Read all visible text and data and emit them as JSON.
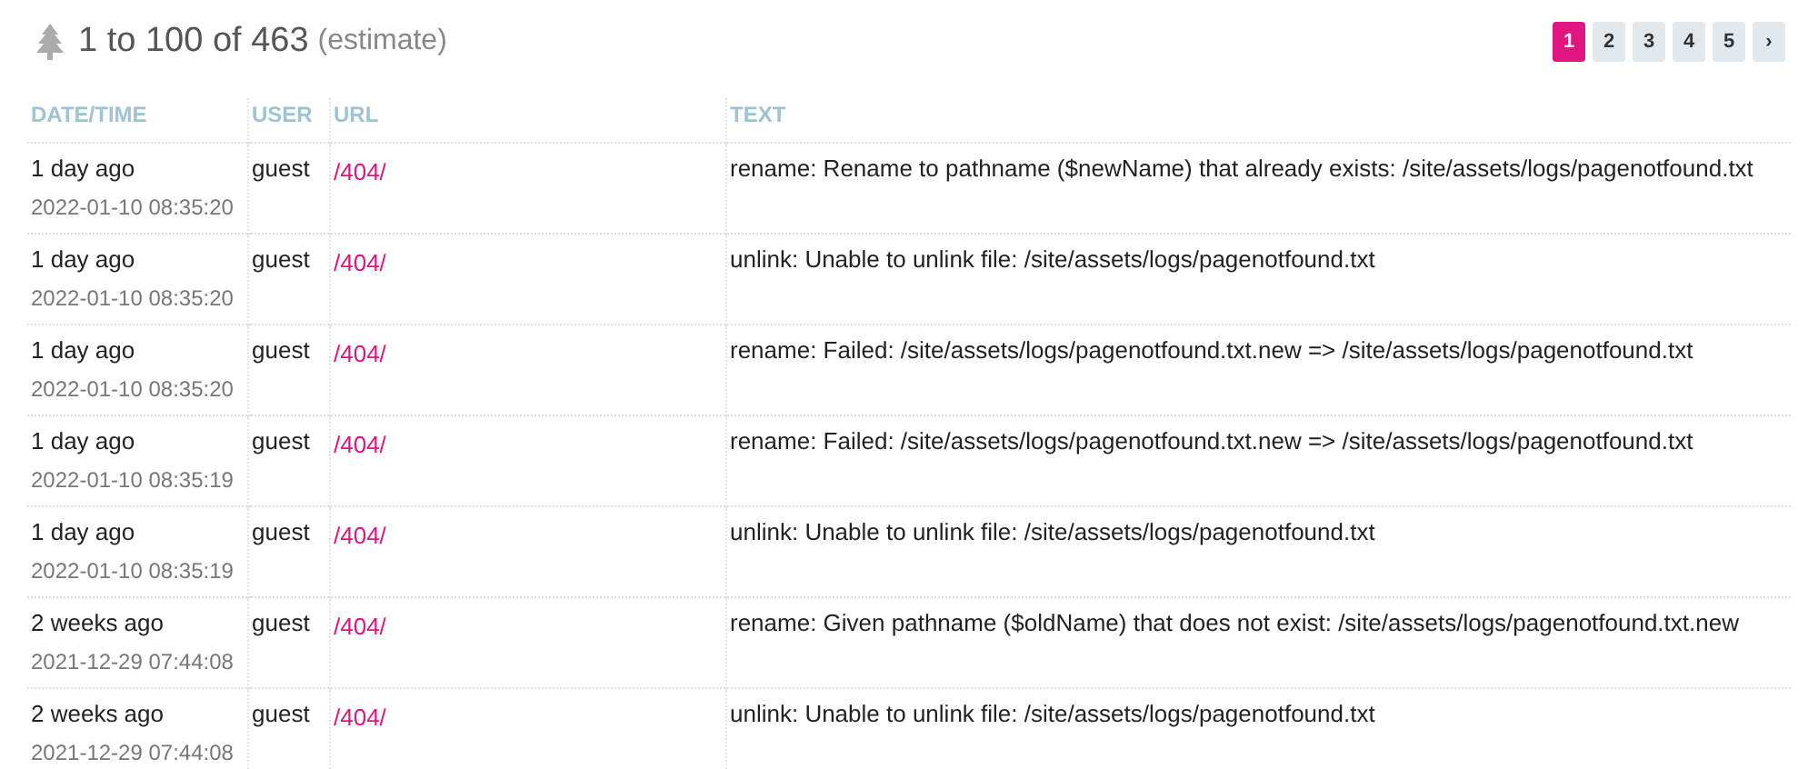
{
  "header": {
    "count": "1 to 100 of 463",
    "note": "(estimate)"
  },
  "pagination": [
    {
      "label": "1",
      "selected": true
    },
    {
      "label": "2",
      "selected": false
    },
    {
      "label": "3",
      "selected": false
    },
    {
      "label": "4",
      "selected": false
    },
    {
      "label": "5",
      "selected": false
    },
    {
      "label": "›",
      "selected": false
    }
  ],
  "table": {
    "columns": [
      "DATE/TIME",
      "USER",
      "URL",
      "TEXT"
    ],
    "rows": [
      {
        "when": "1 day ago",
        "date": "2022-01-10 08:35:20",
        "user": "guest",
        "url": "/404/",
        "text": "rename: Rename to pathname ($newName) that already exists: /site/assets/logs/pagenotfound.txt"
      },
      {
        "when": "1 day ago",
        "date": "2022-01-10 08:35:20",
        "user": "guest",
        "url": "/404/",
        "text": "unlink: Unable to unlink file: /site/assets/logs/pagenotfound.txt"
      },
      {
        "when": "1 day ago",
        "date": "2022-01-10 08:35:20",
        "user": "guest",
        "url": "/404/",
        "text": "rename: Failed: /site/assets/logs/pagenotfound.txt.new => /site/assets/logs/pagenotfound.txt"
      },
      {
        "when": "1 day ago",
        "date": "2022-01-10 08:35:19",
        "user": "guest",
        "url": "/404/",
        "text": "rename: Failed: /site/assets/logs/pagenotfound.txt.new => /site/assets/logs/pagenotfound.txt"
      },
      {
        "when": "1 day ago",
        "date": "2022-01-10 08:35:19",
        "user": "guest",
        "url": "/404/",
        "text": "unlink: Unable to unlink file: /site/assets/logs/pagenotfound.txt"
      },
      {
        "when": "2 weeks ago",
        "date": "2021-12-29 07:44:08",
        "user": "guest",
        "url": "/404/",
        "text": "rename: Given pathname ($oldName) that does not exist: /site/assets/logs/pagenotfound.txt.new"
      },
      {
        "when": "2 weeks ago",
        "date": "2021-12-29 07:44:08",
        "user": "guest",
        "url": "/404/",
        "text": "unlink: Unable to unlink file: /site/assets/logs/pagenotfound.txt"
      }
    ]
  }
}
